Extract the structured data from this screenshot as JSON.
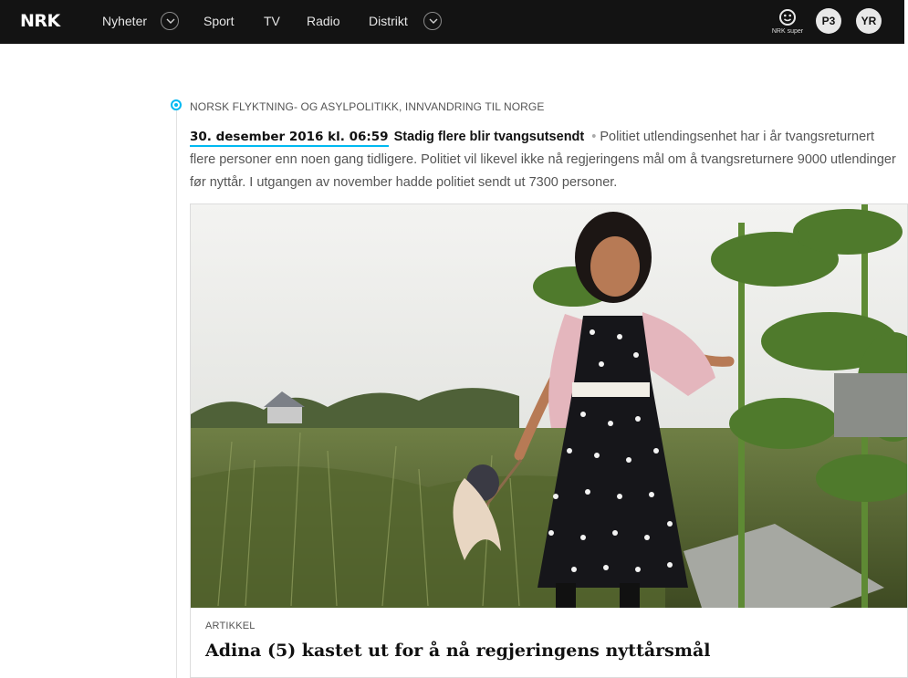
{
  "header": {
    "logo": "NRK",
    "nav": [
      {
        "label": "Nyheter",
        "has_dropdown": true
      },
      {
        "label": "Sport",
        "has_dropdown": false
      },
      {
        "label": "TV",
        "has_dropdown": false
      },
      {
        "label": "Radio",
        "has_dropdown": false
      },
      {
        "label": "Distrikt",
        "has_dropdown": true
      }
    ],
    "right_links": {
      "super_label": "NRK super",
      "p3_label": "P3",
      "yr_label": "YR"
    },
    "colors": {
      "background": "#131313",
      "text": "#e6e6e6"
    }
  },
  "timeline": {
    "accent_color": "#00b9f2",
    "category": "NORSK FLYKTNING- OG ASYLPOLITIKK, INNVANDRING TIL NORGE",
    "entry": {
      "date": "30. desember 2016 kl. 06:59",
      "title": "Stadig flere blir tvangsutsendt",
      "separator": "•",
      "body": "Politiet utlendingsenhet har i år tvangsreturnert flere personer enn noen gang tidligere. Politiet vil likevel ikke nå regjeringens mål om å tvangsreturnere 9000 utlendinger før nyttår. I utgangen av november hadde politiet sendt ut 7300 personer."
    },
    "card": {
      "image_icon": "photo-girl-in-garden",
      "kicker": "ARTIKKEL",
      "title": "Adina (5) kastet ut for å nå regjeringens nyttårsmål"
    }
  }
}
